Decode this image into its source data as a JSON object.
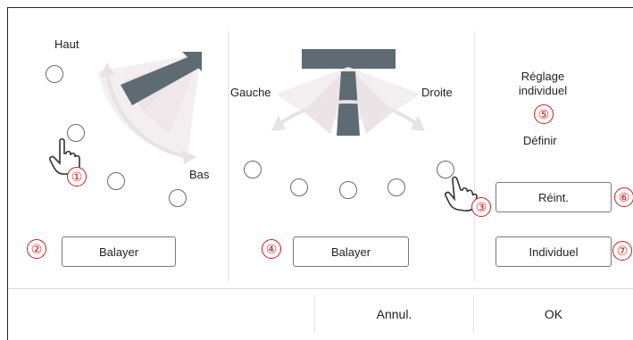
{
  "vertical_section": {
    "top_label": "Haut",
    "bottom_label": "Bas",
    "sweep_button": "Balayer"
  },
  "horizontal_section": {
    "left_label": "Gauche",
    "right_label": "Droite",
    "sweep_button": "Balayer"
  },
  "individual_section": {
    "title": "Réglage individuel",
    "define_label": "Définir",
    "reset_button": "Réint.",
    "individual_button": "Individuel"
  },
  "footer": {
    "cancel_label": "Annul.",
    "ok_label": "OK"
  },
  "callouts": [
    "①",
    "②",
    "③",
    "④",
    "⑤",
    "⑥",
    "⑦"
  ],
  "colors": {
    "callout_red": "#d11a1a",
    "vane_dark": "#5f6b73",
    "fan_light": "#efe7ea"
  }
}
